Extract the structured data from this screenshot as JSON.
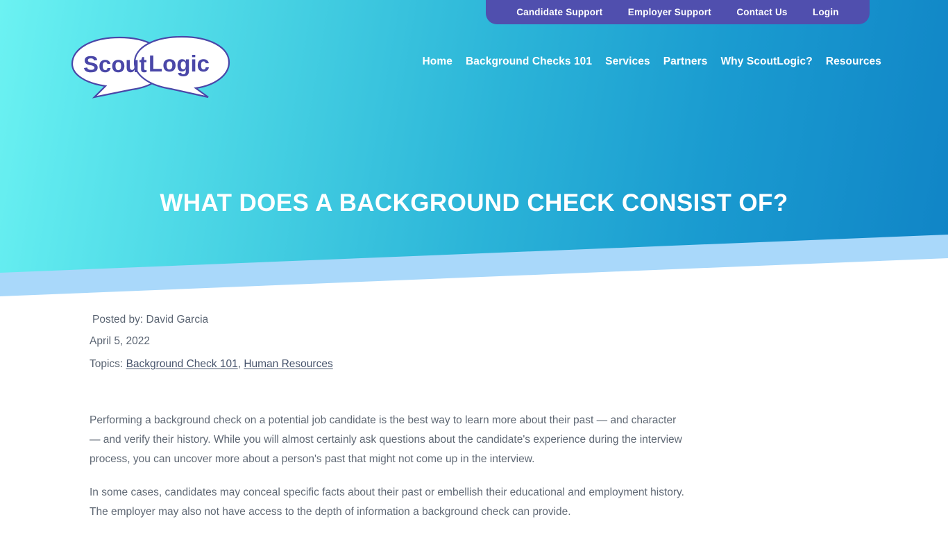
{
  "topbar": {
    "links": [
      {
        "label": "Candidate Support"
      },
      {
        "label": "Employer Support"
      },
      {
        "label": "Contact Us"
      },
      {
        "label": "Login"
      }
    ]
  },
  "logo": {
    "word_left": "Scout",
    "word_right": "Logic",
    "text_color": "#4a47a8",
    "bubble_fill": "#ffffff",
    "bubble_stroke": "#4a47a8"
  },
  "nav": {
    "items": [
      {
        "label": "Home"
      },
      {
        "label": "Background Checks 101"
      },
      {
        "label": "Services"
      },
      {
        "label": "Partners"
      },
      {
        "label": "Why ScoutLogic?"
      },
      {
        "label": "Resources"
      }
    ]
  },
  "hero": {
    "title": "WHAT DOES A BACKGROUND CHECK CONSIST OF?",
    "gradient_start": "#6cf2f2",
    "gradient_end": "#1084c6",
    "band_color": "#a9d8fa",
    "topbar_color": "#504fae"
  },
  "article": {
    "author_line": " Posted by: David Garcia",
    "date": "April 5, 2022",
    "topics_label": "Topics:",
    "topics": [
      {
        "label": "Background Check 101"
      },
      {
        "label": "Human Resources"
      }
    ],
    "topics_separator": ",",
    "paragraphs": [
      "Performing a background check on a potential job candidate is the best way to learn more about their past — and character — and verify their history. While you will almost certainly ask questions about the candidate's experience during the interview process, you can uncover more about a person's past that might not come up in the interview.",
      "In some cases, candidates may conceal specific facts about their past or embellish their educational and employment history. The employer may also not have access to the depth of information a background check can provide."
    ]
  }
}
